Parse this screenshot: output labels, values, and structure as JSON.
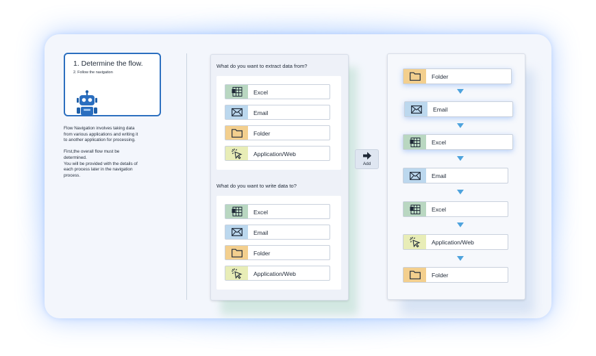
{
  "intro": {
    "title": "1. Determine the flow.",
    "subtitle": "2. Follow the navigation",
    "robot_icon": "robot-icon",
    "description": "Flow Navigation involves taking data\nfrom various applications and writing it\nto another application for processing.\n\nFirst,the overall flow must be\ndetermined.\nYou will be provided with the details of\neach process later in the navigation\nprocess."
  },
  "extract": {
    "question": "What do you want to extract data from?",
    "options": [
      {
        "label": "Excel",
        "icon": "excel-icon"
      },
      {
        "label": "Email",
        "icon": "email-icon"
      },
      {
        "label": "Folder",
        "icon": "folder-icon"
      },
      {
        "label": "Application/Web",
        "icon": "cursor-click-icon"
      }
    ]
  },
  "write": {
    "question": "What do you want to write data to?",
    "options": [
      {
        "label": "Excel",
        "icon": "excel-icon"
      },
      {
        "label": "Email",
        "icon": "email-icon"
      },
      {
        "label": "Folder",
        "icon": "folder-icon"
      },
      {
        "label": "Application/Web",
        "icon": "cursor-click-icon"
      }
    ]
  },
  "add_button": {
    "label": "Add",
    "icon": "arrow-right-icon"
  },
  "flow": {
    "steps": [
      {
        "label": "Folder",
        "icon": "folder-icon"
      },
      {
        "label": "Email",
        "icon": "email-icon"
      },
      {
        "label": "Excel",
        "icon": "excel-icon"
      },
      {
        "label": "Email",
        "icon": "email-icon"
      },
      {
        "label": "Excel",
        "icon": "excel-icon"
      },
      {
        "label": "Application/Web",
        "icon": "cursor-click-icon"
      },
      {
        "label": "Folder",
        "icon": "folder-icon"
      }
    ]
  },
  "colors": {
    "accent_blue": "#2a6ebf",
    "arrow_blue": "#4ea3dd",
    "excel_bg": "#b9d7c1",
    "email_bg": "#bcd8ee",
    "folder_bg": "#f3cf8e",
    "app_bg": "#e8edb7"
  }
}
